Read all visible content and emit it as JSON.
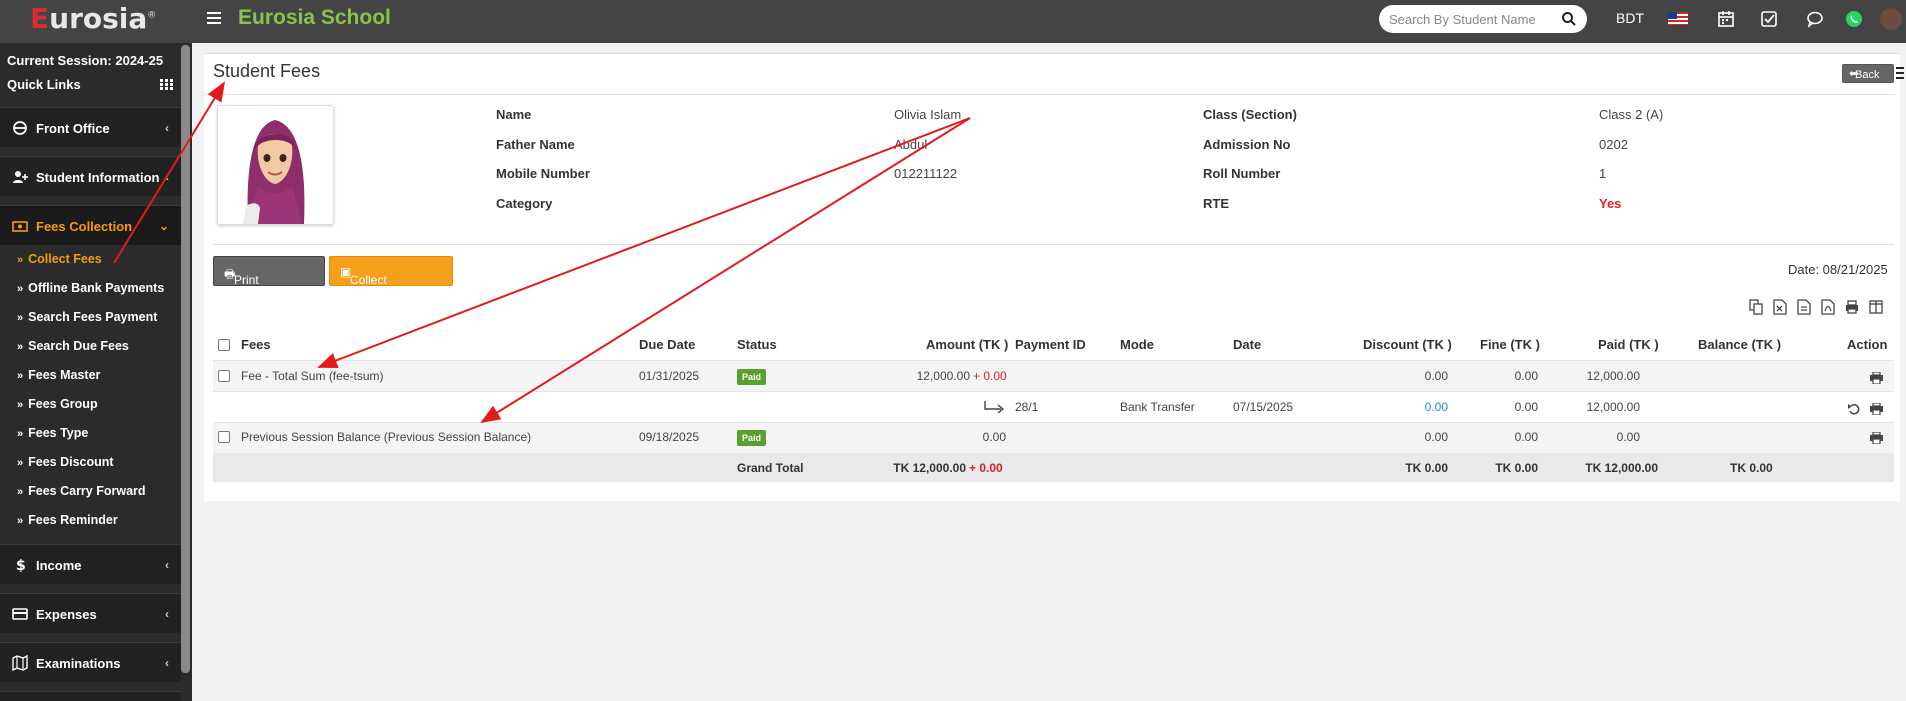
{
  "topbar": {
    "logo_first": "E",
    "logo_rest": "urosia",
    "logo_mark": "®",
    "school_name": "Eurosia School",
    "search_placeholder": "Search By Student Name",
    "currency": "BDT"
  },
  "sidebar": {
    "session": "Current Session: 2024-25",
    "quick_links": "Quick Links",
    "nav": [
      {
        "label": "Front Office",
        "icon": "concierge-icon"
      },
      {
        "label": "Student Information",
        "icon": "user-add-icon"
      },
      {
        "label": "Fees Collection",
        "icon": "money-icon"
      },
      {
        "label": "Income",
        "icon": "dollar-icon"
      },
      {
        "label": "Expenses",
        "icon": "credit-card-icon"
      },
      {
        "label": "Examinations",
        "icon": "map-icon"
      }
    ],
    "sub_items": [
      "Collect Fees",
      "Offline Bank Payments",
      "Search Fees Payment",
      "Search Due Fees",
      "Fees Master",
      "Fees Group",
      "Fees Type",
      "Fees Discount",
      "Fees Carry Forward",
      "Fees Reminder"
    ]
  },
  "page": {
    "title": "Student Fees",
    "back": "Back",
    "date": "Date: 08/21/2025",
    "print_selected": "Print Selected",
    "collect_selected": "Collect Selected"
  },
  "student": {
    "name_label": "Name",
    "name": "Olivia Islam",
    "father_label": "Father Name",
    "father": "Abdul",
    "mobile_label": "Mobile Number",
    "mobile": "012211122",
    "category_label": "Category",
    "category": "",
    "class_label": "Class (Section)",
    "class": "Class 2 (A)",
    "admission_label": "Admission No",
    "admission": "0202",
    "roll_label": "Roll Number",
    "roll": "1",
    "rte_label": "RTE",
    "rte": "Yes"
  },
  "table": {
    "headers": [
      "Fees",
      "Due Date",
      "Status",
      "Amount (TK )",
      "Payment ID",
      "Mode",
      "Date",
      "Discount (TK )",
      "Fine (TK )",
      "Paid (TK )",
      "Balance (TK )",
      "Action"
    ],
    "rows": [
      {
        "fees": "Fee - Total Sum (fee-tsum)",
        "due": "01/31/2025",
        "status": "Paid",
        "amount": "12,000.00",
        "amount_extra": "+ 0.00",
        "discount": "0.00",
        "fine": "0.00",
        "paid": "12,000.00"
      },
      {
        "payment_id": "28/1",
        "mode": "Bank Transfer",
        "date": "07/15/2025",
        "discount": "0.00",
        "fine": "0.00",
        "paid": "12,000.00"
      },
      {
        "fees": "Previous Session Balance (Previous Session Balance)",
        "due": "09/18/2025",
        "status": "Paid",
        "amount": "0.00",
        "discount": "0.00",
        "fine": "0.00",
        "paid": "0.00"
      }
    ],
    "total": {
      "label": "Grand Total",
      "amount": "TK 12,000.00",
      "amount_extra": "+ 0.00",
      "discount": "TK 0.00",
      "fine": "TK 0.00",
      "paid": "TK 12,000.00",
      "balance": "TK 0.00"
    }
  },
  "colors": {
    "accent": "#f39c12",
    "brand_green": "#8bc34a",
    "paid_badge": "#5aa02c",
    "arrow": "#e31b1b"
  }
}
